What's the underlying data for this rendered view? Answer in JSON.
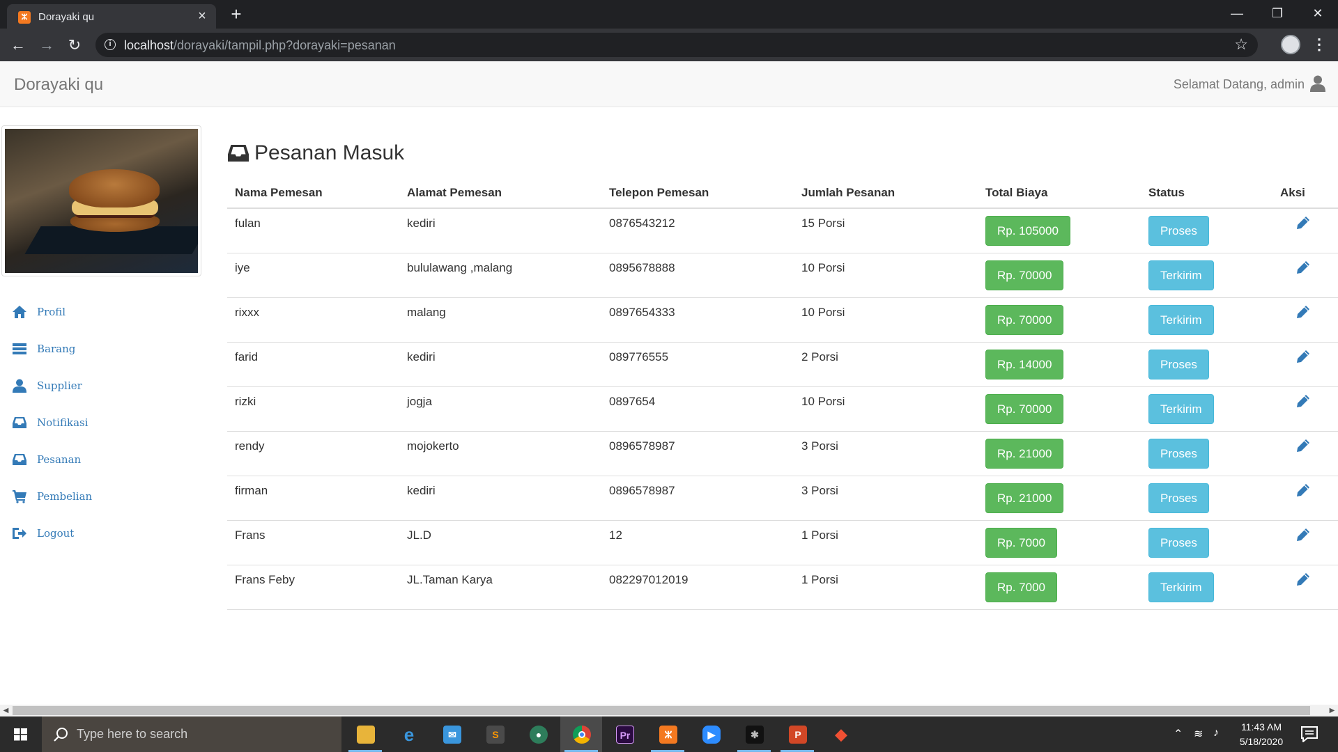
{
  "browser": {
    "tab_title": "Dorayaki qu",
    "url_host": "localhost",
    "url_path": "/dorayaki/tampil.php?dorayaki=pesanan"
  },
  "navbar": {
    "brand": "Dorayaki qu",
    "welcome": "Selamat Datang, admin"
  },
  "sidebar": {
    "items": [
      {
        "label": "Profil",
        "icon": "home-icon"
      },
      {
        "label": "Barang",
        "icon": "list-icon"
      },
      {
        "label": "Supplier",
        "icon": "user-icon"
      },
      {
        "label": "Notifikasi",
        "icon": "inbox-icon"
      },
      {
        "label": "Pesanan",
        "icon": "inbox-icon"
      },
      {
        "label": "Pembelian",
        "icon": "shopping-cart-icon"
      },
      {
        "label": "Logout",
        "icon": "log-out-icon"
      }
    ]
  },
  "main": {
    "heading": "Pesanan Masuk",
    "columns": [
      "Nama Pemesan",
      "Alamat Pemesan",
      "Telepon Pemesan",
      "Jumlah Pesanan",
      "Total Biaya",
      "Status",
      "Aksi"
    ],
    "rows": [
      {
        "nama": "fulan",
        "alamat": "kediri",
        "telepon": "0876543212",
        "jumlah": "15 Porsi",
        "total": "Rp. 105000",
        "status": "Proses"
      },
      {
        "nama": "iye",
        "alamat": "bululawang ,malang",
        "telepon": "0895678888",
        "jumlah": "10 Porsi",
        "total": "Rp. 70000",
        "status": "Terkirim"
      },
      {
        "nama": "rixxx",
        "alamat": "malang",
        "telepon": "0897654333",
        "jumlah": "10 Porsi",
        "total": "Rp. 70000",
        "status": "Terkirim"
      },
      {
        "nama": "farid",
        "alamat": "kediri",
        "telepon": "089776555",
        "jumlah": "2 Porsi",
        "total": "Rp. 14000",
        "status": "Proses"
      },
      {
        "nama": "rizki",
        "alamat": "jogja",
        "telepon": "0897654",
        "jumlah": "10 Porsi",
        "total": "Rp. 70000",
        "status": "Terkirim"
      },
      {
        "nama": "rendy",
        "alamat": "mojokerto",
        "telepon": "0896578987",
        "jumlah": "3 Porsi",
        "total": "Rp. 21000",
        "status": "Proses"
      },
      {
        "nama": "firman",
        "alamat": "kediri",
        "telepon": "0896578987",
        "jumlah": "3 Porsi",
        "total": "Rp. 21000",
        "status": "Proses"
      },
      {
        "nama": "Frans",
        "alamat": "JL.D",
        "telepon": "12",
        "jumlah": "1 Porsi",
        "total": "Rp. 7000",
        "status": "Proses"
      },
      {
        "nama": "Frans Feby",
        "alamat": "JL.Taman Karya",
        "telepon": "082297012019",
        "jumlah": "1 Porsi",
        "total": "Rp. 7000",
        "status": "Terkirim"
      }
    ]
  },
  "taskbar": {
    "search_placeholder": "Type here to search",
    "time": "11:43 AM",
    "date": "5/18/2020"
  },
  "colors": {
    "success": "#5cb85c",
    "info": "#5bc0de",
    "link": "#337ab7"
  }
}
